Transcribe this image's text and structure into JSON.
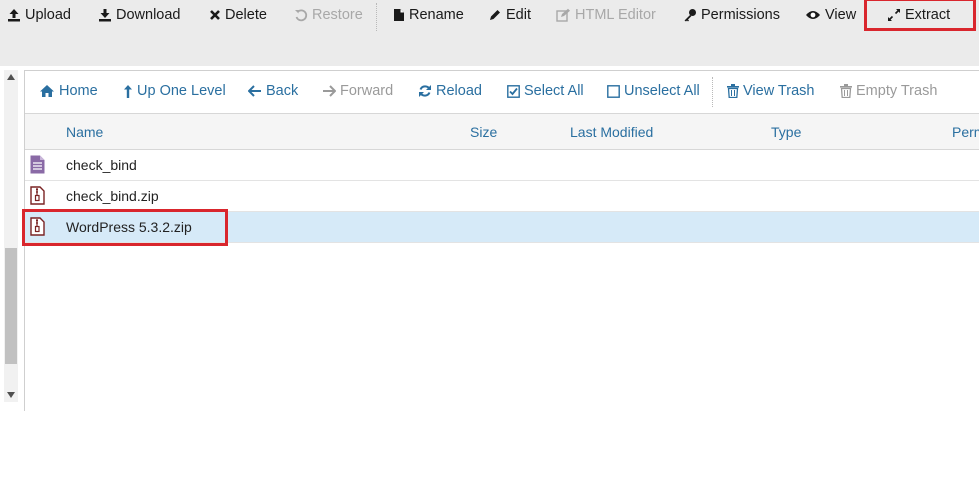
{
  "toolbar": {
    "upload": "Upload",
    "download": "Download",
    "delete": "Delete",
    "restore": "Restore",
    "rename": "Rename",
    "edit": "Edit",
    "html_editor": "HTML Editor",
    "permissions": "Permissions",
    "view": "View",
    "extract": "Extract"
  },
  "navbar": {
    "home": "Home",
    "up_one_level": "Up One Level",
    "back": "Back",
    "forward": "Forward",
    "reload": "Reload",
    "select_all": "Select All",
    "unselect_all": "Unselect All",
    "view_trash": "View Trash",
    "empty_trash": "Empty Trash"
  },
  "table": {
    "columns": [
      "Name",
      "Size",
      "Last Modified",
      "Type",
      "Perms"
    ],
    "rows": [
      {
        "name": "check_bind",
        "icon": "text-file-icon"
      },
      {
        "name": "check_bind.zip",
        "icon": "zip-file-icon"
      },
      {
        "name": "WordPress 5.3.2.zip",
        "icon": "zip-file-icon",
        "selected": true
      }
    ]
  },
  "colors": {
    "highlight": "#d9262d",
    "link": "#2a6fa0",
    "selected_row": "#d6eaf8",
    "toolbar_bg": "#ebebeb"
  }
}
